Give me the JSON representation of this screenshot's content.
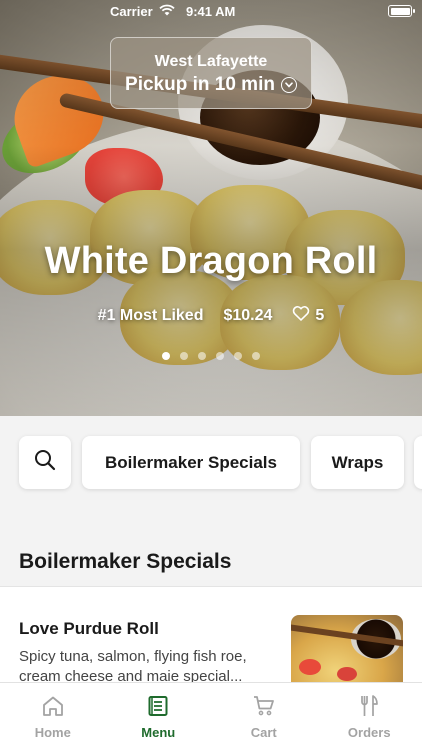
{
  "status_bar": {
    "carrier": "Carrier",
    "time": "9:41 AM"
  },
  "location": {
    "name": "West Lafayette",
    "pickup": "Pickup in 10 min"
  },
  "hero": {
    "title": "White Dragon Roll",
    "badge": "#1 Most Liked",
    "price": "$10.24",
    "likes": "5",
    "carousel_pages": 6,
    "carousel_active": 1
  },
  "categories": {
    "search_icon": "search-icon",
    "items": [
      "Boilermaker Specials",
      "Wraps"
    ]
  },
  "section": {
    "title": "Boilermaker Specials",
    "items": [
      {
        "name": "Love Purdue Roll",
        "description": "Spicy tuna, salmon, flying fish roe, cream cheese and maie special..."
      }
    ]
  },
  "tabbar": {
    "active_color": "#1f6b2d",
    "inactive_color": "#a3a3a3",
    "tabs": [
      {
        "label": "Home",
        "icon": "home-icon"
      },
      {
        "label": "Menu",
        "icon": "menu-icon"
      },
      {
        "label": "Cart",
        "icon": "cart-icon"
      },
      {
        "label": "Orders",
        "icon": "utensils-icon"
      }
    ]
  }
}
